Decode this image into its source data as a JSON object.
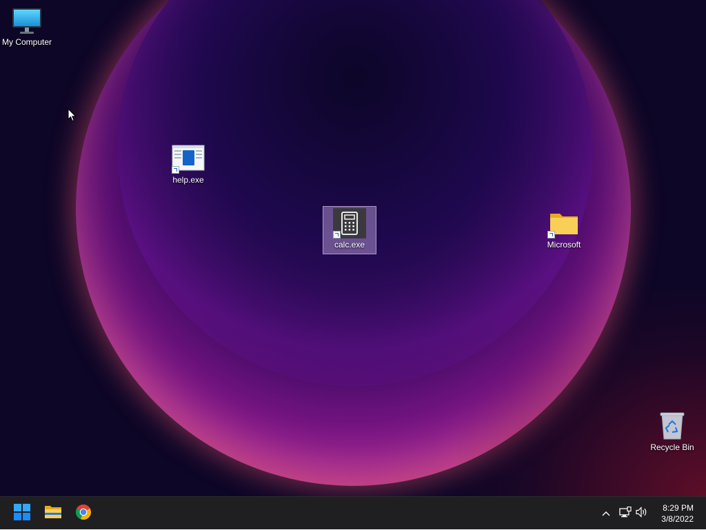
{
  "desktop": {
    "icons": [
      {
        "label": "My Computer",
        "icon": "monitor-icon"
      },
      {
        "label": "help.exe",
        "icon": "help-window-icon"
      },
      {
        "label": "calc.exe",
        "icon": "calculator-icon",
        "selected": true
      },
      {
        "label": "Microsoft",
        "icon": "folder-icon"
      },
      {
        "label": "Recycle Bin",
        "icon": "recycle-bin-icon"
      }
    ]
  },
  "taskbar": {
    "pinned": [
      {
        "name": "Start",
        "icon": "windows-logo-icon"
      },
      {
        "name": "File Explorer",
        "icon": "folder-icon"
      },
      {
        "name": "Google Chrome",
        "icon": "chrome-icon"
      }
    ],
    "tray": {
      "chevron": "chevron-up-icon",
      "network": "network-icon",
      "volume": "volume-icon"
    },
    "clock": {
      "time": "8:29 PM",
      "date": "3/8/2022"
    }
  },
  "colors": {
    "taskbar_bg": "#1f1f22",
    "selection": "#c8aae6",
    "folder": "#f7c948",
    "accent_blue": "#1a8cff"
  }
}
